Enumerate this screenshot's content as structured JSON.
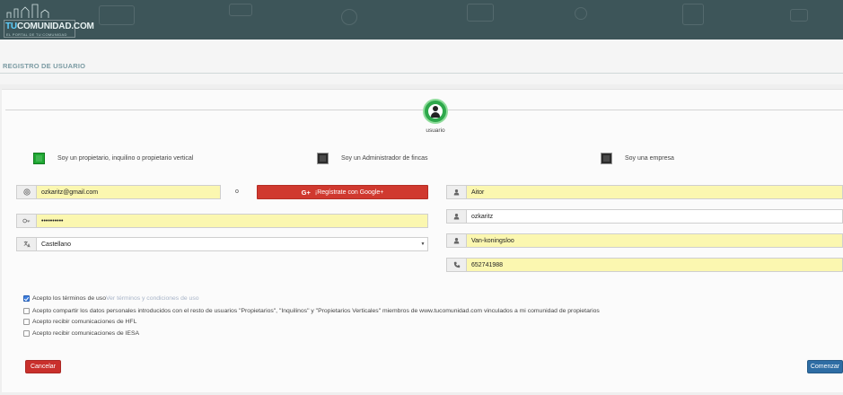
{
  "header": {
    "logo": {
      "brand_prefix": "TU",
      "brand_rest": "COMUNIDAD.COM",
      "tagline": "EL PORTAL DE TU COMUNIDAD"
    },
    "colors": {
      "bar": "#3d5559",
      "accent": "#5fd0ff"
    }
  },
  "page": {
    "title": "REGISTRO DE USUARIO"
  },
  "profile": {
    "icon": "user-icon",
    "label": "usuario",
    "color": "#2ea84b"
  },
  "roles": [
    {
      "label": "Soy un propietario, inquilino o propietario vertical",
      "selected": true
    },
    {
      "label": "Soy un Administrador de fincas",
      "selected": false
    },
    {
      "label": "Soy una empresa",
      "selected": false
    }
  ],
  "left_form": {
    "email": {
      "icon": "at-icon",
      "value": "ozkaritz@gmail.com"
    },
    "or_text": "o",
    "google_button": {
      "icon": "google-plus-icon",
      "icon_text": "G+",
      "label": "¡Regístrate con Google+"
    },
    "password": {
      "icon": "key-icon",
      "value": "••••••••••"
    },
    "language": {
      "icon": "language-icon",
      "value": "Castellano"
    }
  },
  "right_form": {
    "first_name": {
      "icon": "user-icon",
      "value": "Aitor"
    },
    "last_name_1": {
      "icon": "user-icon",
      "value": "ozkaritz"
    },
    "last_name_2": {
      "icon": "user-icon",
      "value": "Van-koningsloo"
    },
    "phone": {
      "icon": "phone-icon",
      "value": "652741988"
    }
  },
  "consents": [
    {
      "label": "Acepto los términos de uso",
      "link": "Ver términos y condiciones de uso",
      "checked": true
    },
    {
      "label": "Acepto compartir los datos personales introducidos con el resto de usuarios \"Propietarios\", \"Inquilinos\" y \"Propietarios Verticales\" miembros de www.tucomunidad.com vinculados a mi comunidad de propietarios",
      "link": "",
      "checked": false
    },
    {
      "label": "Acepto recibir comunicaciones de HFL",
      "link": "",
      "checked": false
    },
    {
      "label": "Acepto recibir comunicaciones de IESA",
      "link": "",
      "checked": false
    }
  ],
  "actions": {
    "cancel": "Cancelar",
    "start": "Comenzar"
  }
}
